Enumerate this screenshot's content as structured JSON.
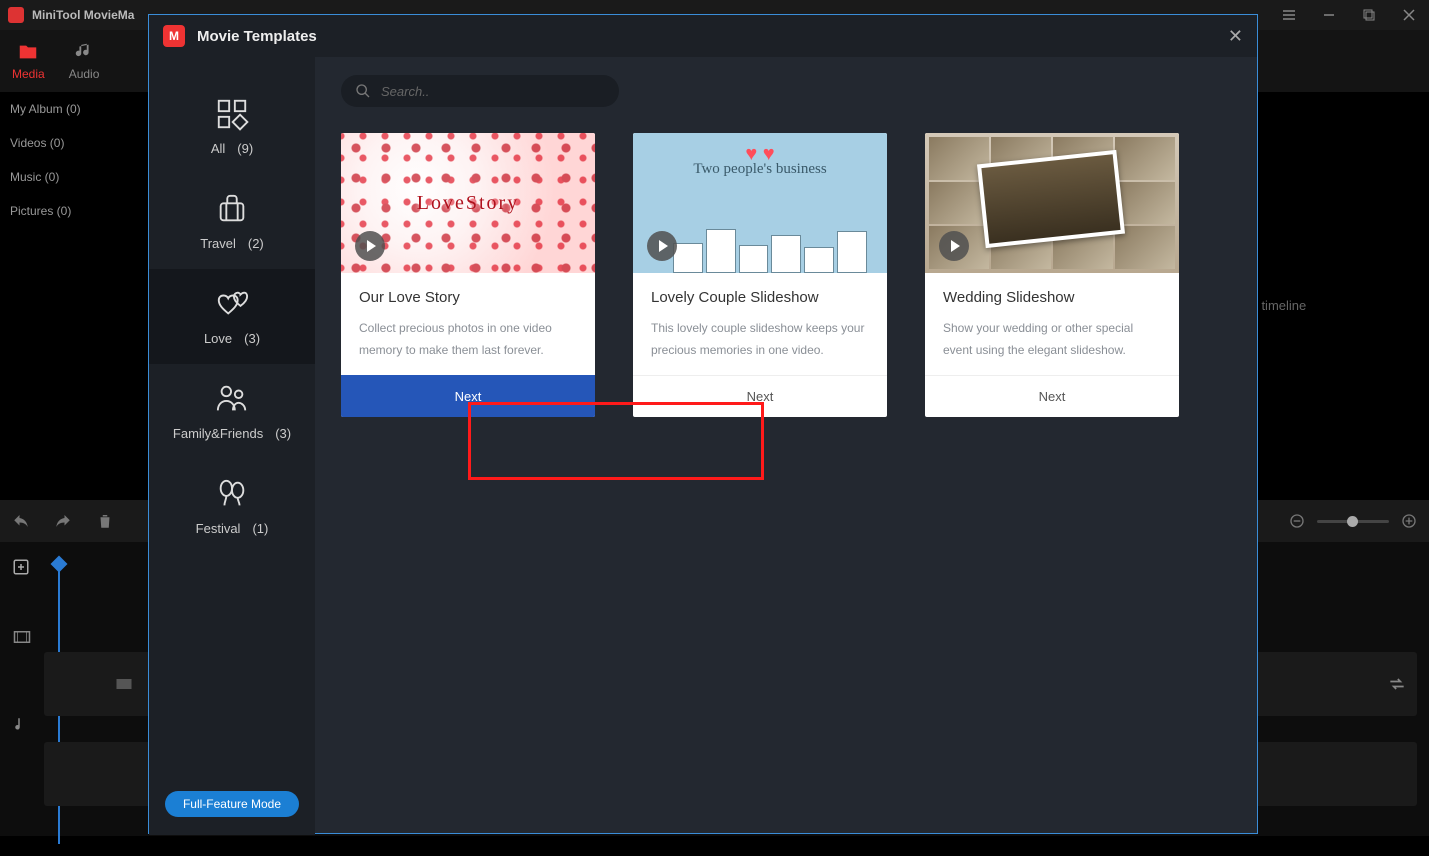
{
  "app_title": "MiniTool MovieMa",
  "dialog": {
    "title": "Movie Templates",
    "search_placeholder": "Search..",
    "full_feature_label": "Full-Feature Mode",
    "categories": [
      {
        "label": "All",
        "count": "(9)"
      },
      {
        "label": "Travel",
        "count": "(2)"
      },
      {
        "label": "Love",
        "count": "(3)"
      },
      {
        "label": "Family&Friends",
        "count": "(3)"
      },
      {
        "label": "Festival",
        "count": "(1)"
      }
    ],
    "cards": [
      {
        "thumb_text": "LoveStory",
        "title": "Our Love Story",
        "desc": "Collect precious photos in one video memory to make them last forever.",
        "next": "Next"
      },
      {
        "thumb_text": "Two people's business",
        "title": "Lovely Couple Slideshow",
        "desc": "This lovely couple slideshow keeps your precious memories in one video.",
        "next": "Next"
      },
      {
        "thumb_text": "",
        "title": "Wedding Slideshow",
        "desc": "Show your wedding or other special event using the elegant slideshow.",
        "next": "Next"
      }
    ]
  },
  "toolbar": {
    "media": "Media",
    "audio": "Audio"
  },
  "sidebar_items": [
    "My Album (0)",
    "Videos (0)",
    "Music (0)",
    "Pictures (0)"
  ],
  "bg_hint": "ted on the timeline"
}
